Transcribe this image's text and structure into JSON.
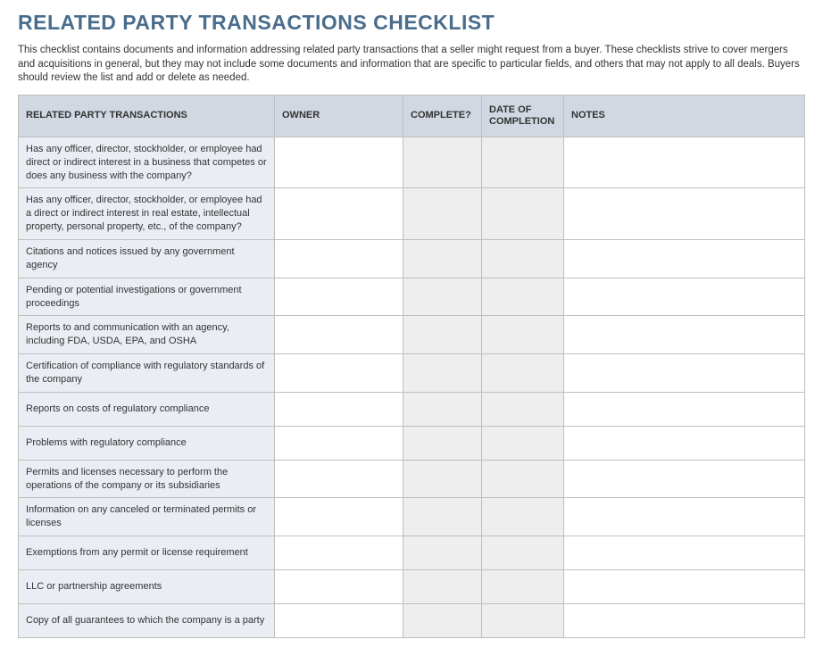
{
  "title": "RELATED PARTY TRANSACTIONS CHECKLIST",
  "description": "This checklist contains documents and information addressing related party transactions that a seller might request from a buyer. These checklists strive to cover mergers and acquisitions in general, but they may not include some documents and information that are specific to particular fields, and others that may not apply to all deals. Buyers should review the list and add or delete as needed.",
  "columns": {
    "item": "RELATED PARTY TRANSACTIONS",
    "owner": "OWNER",
    "complete": "COMPLETE?",
    "date": "DATE OF COMPLETION",
    "notes": "NOTES"
  },
  "rows": [
    {
      "item": "Has any officer, director, stockholder, or employee had direct or indirect interest in a business that competes or does any business with the company?",
      "owner": "",
      "complete": "",
      "date": "",
      "notes": ""
    },
    {
      "item": "Has any officer, director, stockholder, or employee had a direct or indirect interest in real estate, intellectual property, personal property, etc., of the company?",
      "owner": "",
      "complete": "",
      "date": "",
      "notes": ""
    },
    {
      "item": "Citations and notices issued by any government agency",
      "owner": "",
      "complete": "",
      "date": "",
      "notes": ""
    },
    {
      "item": "Pending or potential investigations or government proceedings",
      "owner": "",
      "complete": "",
      "date": "",
      "notes": ""
    },
    {
      "item": "Reports to and communication with an agency, including FDA, USDA, EPA, and OSHA",
      "owner": "",
      "complete": "",
      "date": "",
      "notes": ""
    },
    {
      "item": "Certification of compliance with regulatory standards of the company",
      "owner": "",
      "complete": "",
      "date": "",
      "notes": ""
    },
    {
      "item": "Reports on costs of regulatory compliance",
      "owner": "",
      "complete": "",
      "date": "",
      "notes": ""
    },
    {
      "item": "Problems with regulatory compliance",
      "owner": "",
      "complete": "",
      "date": "",
      "notes": ""
    },
    {
      "item": "Permits and licenses necessary to perform the operations of the company or its subsidiaries",
      "owner": "",
      "complete": "",
      "date": "",
      "notes": ""
    },
    {
      "item": "Information on any canceled or terminated permits or licenses",
      "owner": "",
      "complete": "",
      "date": "",
      "notes": ""
    },
    {
      "item": "Exemptions from any permit or license requirement",
      "owner": "",
      "complete": "",
      "date": "",
      "notes": ""
    },
    {
      "item": "LLC or partnership agreements",
      "owner": "",
      "complete": "",
      "date": "",
      "notes": ""
    },
    {
      "item": "Copy of all guarantees to which the company is a party",
      "owner": "",
      "complete": "",
      "date": "",
      "notes": ""
    }
  ]
}
